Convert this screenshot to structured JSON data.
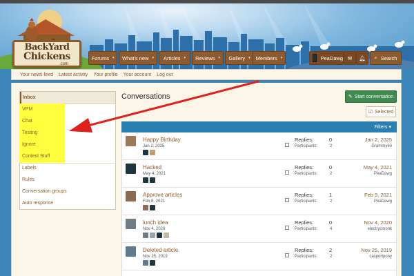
{
  "header": {
    "logo_line1": "BackYard",
    "logo_line2": "Chickens",
    "logo_dotcom": ".com"
  },
  "nav": {
    "items": [
      {
        "label": "Forums",
        "caret": "▾"
      },
      {
        "label": "What's new",
        "caret": "▾"
      },
      {
        "label": "Articles",
        "caret": "▾"
      },
      {
        "label": "Reviews",
        "caret": "▾"
      },
      {
        "label": "Gallery",
        "caret": "▾"
      },
      {
        "label": "Members",
        "caret": "▾"
      }
    ],
    "user": "PeaDawg",
    "search_label": "Search",
    "icons": [
      "envelope-icon",
      "bell-icon",
      "search-icon"
    ]
  },
  "subnav": {
    "items": [
      "Your news feed",
      "Latest activity",
      "Your profile",
      "Your account",
      "Log out"
    ]
  },
  "sidebar": {
    "items": [
      "Inbox",
      "VPM",
      "Chat",
      "Testing",
      "Ignore",
      "Contest Stuff",
      "Labels",
      "Rules",
      "Conversation groups",
      "Auto response"
    ],
    "highlight_color": "#ffff40"
  },
  "main": {
    "title": "Conversations",
    "start_button": "Start conversation",
    "selected_button": "Selected",
    "filters_label": "Filters",
    "replies_label": "Replies:",
    "participants_label": "Participants:",
    "rows": [
      {
        "title": "Happy Birthday",
        "date": "Jan 2, 2025",
        "replies": "0",
        "participants": "2",
        "last_date": "Jan 2, 2025",
        "last_user": "Grammy60"
      },
      {
        "title": "Hacked",
        "date": "May 4, 2021",
        "replies": "0",
        "participants": "2",
        "last_date": "May 4, 2021",
        "last_user": "PeaDawg"
      },
      {
        "title": "Approve articles",
        "date": "Feb 8, 2021",
        "replies": "1",
        "participants": "2",
        "last_date": "Feb 9, 2021",
        "last_user": "PeaDawg"
      },
      {
        "title": "lunch idea",
        "date": "Nov 4, 2020",
        "replies": "0",
        "participants": "4",
        "last_date": "Nov 4, 2020",
        "last_user": "electrycmonk"
      },
      {
        "title": "Deleted article",
        "date": "Nov 25, 2019",
        "replies": "2",
        "participants": "2",
        "last_date": "Nov 25, 2019",
        "last_user": "casportpony"
      }
    ]
  },
  "colors": {
    "accent_brown": "#8c5a2e",
    "list_header_blue": "#2a7fb0",
    "start_green": "#3f8a4f",
    "arrow_red": "#e0201a"
  }
}
